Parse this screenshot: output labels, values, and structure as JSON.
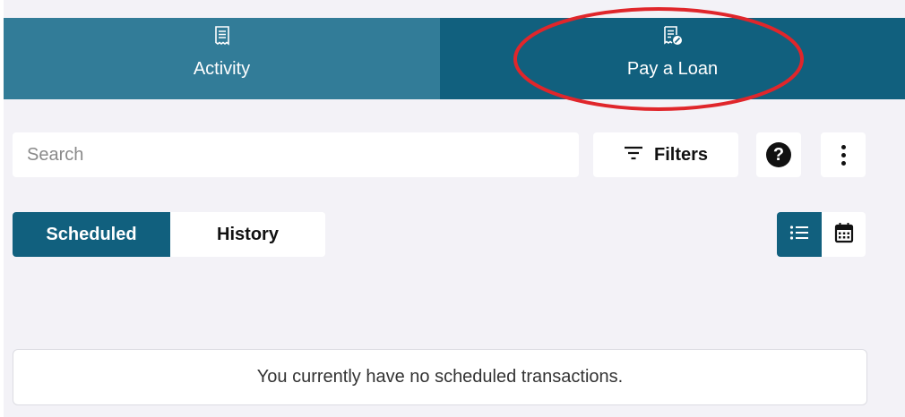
{
  "tabs": [
    {
      "label": "Activity",
      "icon": "receipt-icon"
    },
    {
      "label": "Pay a Loan",
      "icon": "receipt-pay-icon"
    }
  ],
  "search": {
    "placeholder": "Search",
    "value": ""
  },
  "toolbar": {
    "filters_label": "Filters",
    "help_icon": "help-circle-icon",
    "more_icon": "more-vertical-icon"
  },
  "segments": {
    "active": "Scheduled",
    "inactive": "History"
  },
  "view_toggle": {
    "list_icon": "list-icon",
    "calendar_icon": "calendar-icon",
    "selected": "list"
  },
  "empty_state": {
    "message": "You currently have no scheduled transactions."
  },
  "colors": {
    "tab_activity": "#327c98",
    "tab_loan": "#11607e",
    "accent": "#11607e",
    "background": "#f3f2f7",
    "annotation": "#e0262b"
  }
}
